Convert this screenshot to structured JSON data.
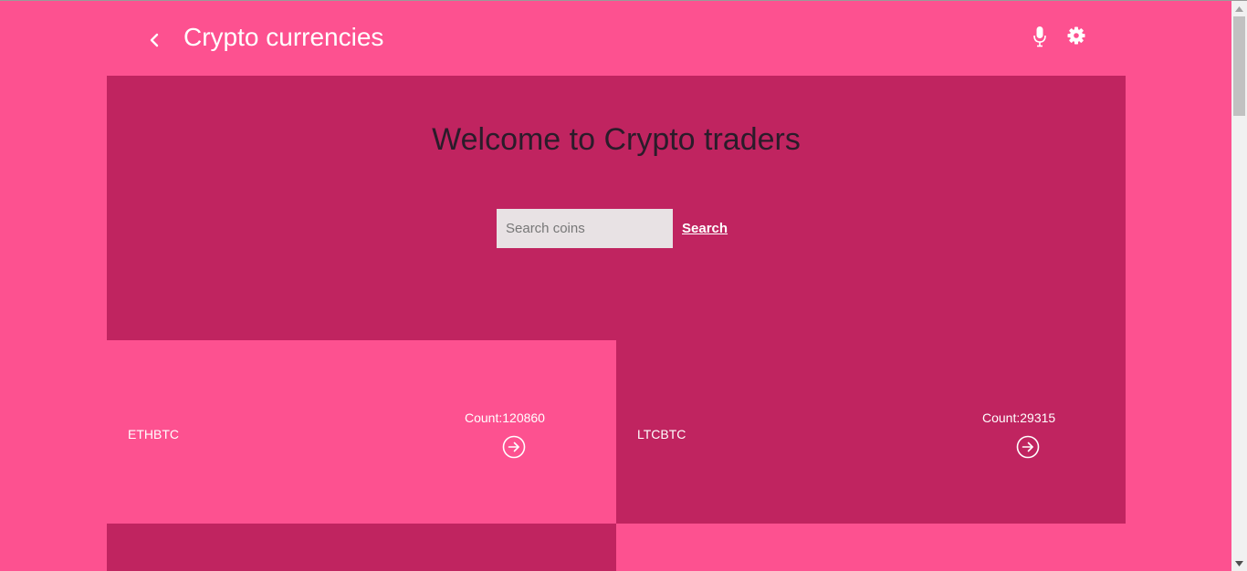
{
  "header": {
    "title": "Crypto currencies",
    "back_icon": "chevron-left-icon",
    "mic_icon": "microphone-icon",
    "settings_icon": "gear-icon"
  },
  "hero": {
    "title": "Welcome to Crypto traders",
    "search": {
      "placeholder": "Search coins",
      "value": "",
      "button_label": "Search"
    }
  },
  "coins": [
    {
      "name": "ETHBTC",
      "count": "Count:120860"
    },
    {
      "name": "LTCBTC",
      "count": "Count:29315"
    }
  ],
  "colors": {
    "page_background": "#fd5190",
    "panel_dark": "#c02460",
    "text_light": "#ffffff",
    "hero_title": "#2a1c2a",
    "search_field": "#e8e2e4"
  }
}
